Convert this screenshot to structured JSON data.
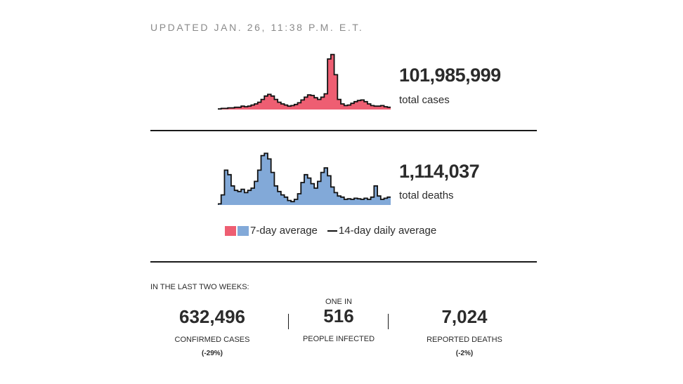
{
  "updated": "UPDATED JAN. 26, 11:38 P.M. E.T.",
  "cases": {
    "number": "101,985,999",
    "label": "total cases"
  },
  "deaths": {
    "number": "1,114,037",
    "label": "total deaths"
  },
  "legend": {
    "avg7": "7-day average",
    "avg14": "14-day daily average"
  },
  "colors": {
    "cases": "#ee5e72",
    "deaths": "#82a9d8",
    "line": "#111111"
  },
  "last_two_weeks": {
    "title": "IN THE LAST TWO WEEKS:",
    "confirmed": {
      "value": "632,496",
      "label": "CONFIRMED CASES",
      "change": "(-29%)"
    },
    "people": {
      "prefix": "ONE IN",
      "value": "516",
      "label": "PEOPLE INFECTED"
    },
    "deaths": {
      "value": "7,024",
      "label": "REPORTED DEATHS",
      "change": "(-2%)"
    }
  },
  "chart_data": [
    {
      "type": "area",
      "series": [
        {
          "values": [
            1,
            2,
            2,
            3,
            3,
            4,
            4,
            6,
            5,
            6,
            8,
            10,
            13,
            18,
            24,
            27,
            24,
            18,
            13,
            10,
            8,
            6,
            7,
            9,
            12,
            17,
            22,
            26,
            25,
            21,
            18,
            22,
            28,
            90,
            98,
            62,
            18,
            10,
            7,
            8,
            11,
            14,
            16,
            17,
            14,
            10,
            7,
            6,
            6,
            7,
            5,
            4
          ]
        }
      ]
    },
    {
      "type": "area",
      "series": [
        {
          "values": [
            2,
            18,
            62,
            54,
            34,
            26,
            24,
            28,
            22,
            26,
            30,
            42,
            62,
            88,
            92,
            82,
            58,
            34,
            24,
            18,
            14,
            8,
            6,
            10,
            20,
            40,
            54,
            48,
            38,
            30,
            42,
            58,
            66,
            52,
            32,
            22,
            16,
            14,
            10,
            11,
            10,
            12,
            11,
            10,
            12,
            10,
            14,
            34,
            16,
            10,
            12,
            14
          ]
        }
      ]
    }
  ]
}
